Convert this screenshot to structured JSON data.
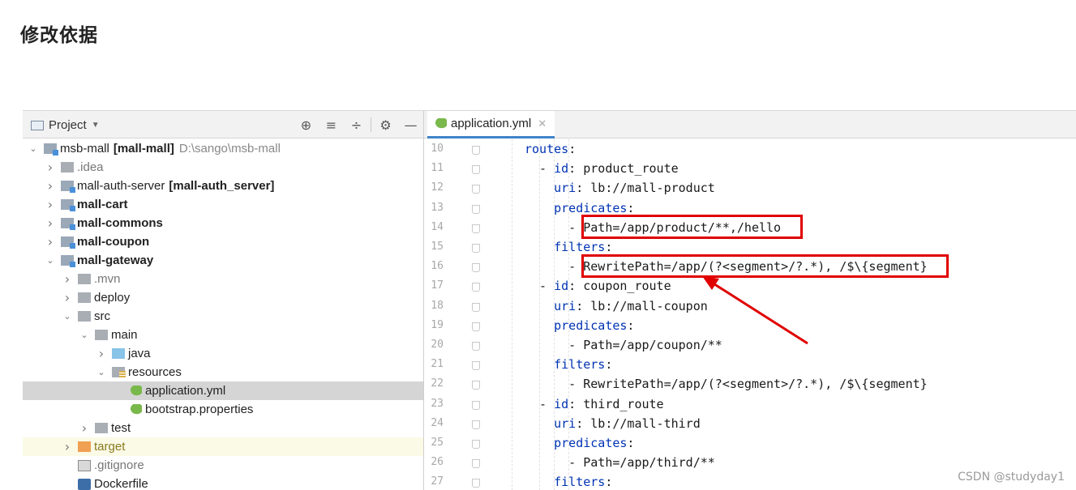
{
  "heading": "修改依据",
  "project_panel": {
    "title": "Project",
    "tree": [
      {
        "label": "msb-mall",
        "bold_suffix": "[mall-mall]",
        "path": "D:\\sango\\msb-mall",
        "arrow": "down",
        "icon": "module-folder-icon",
        "indent": 0
      },
      {
        "label": ".idea",
        "arrow": "right",
        "icon": "folder-icon",
        "indent": 1,
        "dim": true
      },
      {
        "label": "mall-auth-server",
        "bold_suffix": "[mall-auth_server]",
        "arrow": "right",
        "icon": "module-folder-icon",
        "indent": 1
      },
      {
        "label": "mall-cart",
        "arrow": "right",
        "icon": "module-folder-icon",
        "indent": 1,
        "bold": true
      },
      {
        "label": "mall-commons",
        "arrow": "right",
        "icon": "module-folder-icon",
        "indent": 1,
        "bold": true
      },
      {
        "label": "mall-coupon",
        "arrow": "right",
        "icon": "module-folder-icon",
        "indent": 1,
        "bold": true
      },
      {
        "label": "mall-gateway",
        "arrow": "down",
        "icon": "module-folder-icon",
        "indent": 1,
        "bold": true
      },
      {
        "label": ".mvn",
        "arrow": "right",
        "icon": "folder-icon",
        "indent": 2,
        "dim": true
      },
      {
        "label": "deploy",
        "arrow": "right",
        "icon": "folder-icon",
        "indent": 2
      },
      {
        "label": "src",
        "arrow": "down",
        "icon": "folder-icon",
        "indent": 2
      },
      {
        "label": "main",
        "arrow": "down",
        "icon": "folder-icon",
        "indent": 3
      },
      {
        "label": "java",
        "arrow": "right",
        "icon": "source-folder-icon",
        "indent": 4
      },
      {
        "label": "resources",
        "arrow": "down",
        "icon": "resources-folder-icon",
        "indent": 4
      },
      {
        "label": "application.yml",
        "arrow": "",
        "icon": "spring-config-icon",
        "indent": 5,
        "selected": true
      },
      {
        "label": "bootstrap.properties",
        "arrow": "",
        "icon": "spring-config-icon",
        "indent": 5
      },
      {
        "label": "test",
        "arrow": "right",
        "icon": "folder-icon",
        "indent": 3
      },
      {
        "label": "target",
        "arrow": "right",
        "icon": "excluded-folder-icon",
        "indent": 2,
        "olive": true,
        "highlight": true
      },
      {
        "label": ".gitignore",
        "arrow": "",
        "icon": "gitignore-file-icon",
        "indent": 2,
        "dim": true
      },
      {
        "label": "Dockerfile",
        "arrow": "",
        "icon": "docker-file-icon",
        "indent": 2
      }
    ]
  },
  "editor": {
    "tab_label": "application.yml",
    "lines": [
      {
        "n": "10",
        "indent": 16,
        "parts": [
          {
            "t": "routes",
            "k": true
          },
          {
            "t": ":"
          }
        ]
      },
      {
        "n": "11",
        "indent": 18,
        "parts": [
          {
            "t": "- "
          },
          {
            "t": "id",
            "k": true
          },
          {
            "t": ": product_route"
          }
        ]
      },
      {
        "n": "12",
        "indent": 20,
        "parts": [
          {
            "t": "uri",
            "k": true
          },
          {
            "t": ": lb://mall-product"
          }
        ]
      },
      {
        "n": "13",
        "indent": 20,
        "parts": [
          {
            "t": "predicates",
            "k": true
          },
          {
            "t": ":"
          }
        ]
      },
      {
        "n": "14",
        "indent": 22,
        "parts": [
          {
            "t": "- Path=/app/product/**,/hello"
          }
        ]
      },
      {
        "n": "15",
        "indent": 20,
        "parts": [
          {
            "t": "filters",
            "k": true
          },
          {
            "t": ":"
          }
        ]
      },
      {
        "n": "16",
        "indent": 22,
        "parts": [
          {
            "t": "- RewritePath=/app/(?<segment>/?.*), /$\\{segment}"
          }
        ]
      },
      {
        "n": "17",
        "indent": 18,
        "parts": [
          {
            "t": "- "
          },
          {
            "t": "id",
            "k": true
          },
          {
            "t": ": coupon_route"
          }
        ]
      },
      {
        "n": "18",
        "indent": 20,
        "parts": [
          {
            "t": "uri",
            "k": true
          },
          {
            "t": ": lb://mall-coupon"
          }
        ]
      },
      {
        "n": "19",
        "indent": 20,
        "parts": [
          {
            "t": "predicates",
            "k": true
          },
          {
            "t": ":"
          }
        ]
      },
      {
        "n": "20",
        "indent": 22,
        "parts": [
          {
            "t": "- Path=/app/coupon/**"
          }
        ]
      },
      {
        "n": "21",
        "indent": 20,
        "parts": [
          {
            "t": "filters",
            "k": true
          },
          {
            "t": ":"
          }
        ]
      },
      {
        "n": "22",
        "indent": 22,
        "parts": [
          {
            "t": "- RewritePath=/app/(?<segment>/?.*), /$\\{segment}"
          }
        ]
      },
      {
        "n": "23",
        "indent": 18,
        "parts": [
          {
            "t": "- "
          },
          {
            "t": "id",
            "k": true
          },
          {
            "t": ": third_route"
          }
        ]
      },
      {
        "n": "24",
        "indent": 20,
        "parts": [
          {
            "t": "uri",
            "k": true
          },
          {
            "t": ": lb://mall-third"
          }
        ]
      },
      {
        "n": "25",
        "indent": 20,
        "parts": [
          {
            "t": "predicates",
            "k": true
          },
          {
            "t": ":"
          }
        ]
      },
      {
        "n": "26",
        "indent": 22,
        "parts": [
          {
            "t": "- Path=/app/third/**"
          }
        ]
      },
      {
        "n": "27",
        "indent": 20,
        "parts": [
          {
            "t": "filters",
            "k": true
          },
          {
            "t": ":"
          }
        ]
      }
    ]
  },
  "annotation_color": "#e00000",
  "watermark": "CSDN @studyday1"
}
